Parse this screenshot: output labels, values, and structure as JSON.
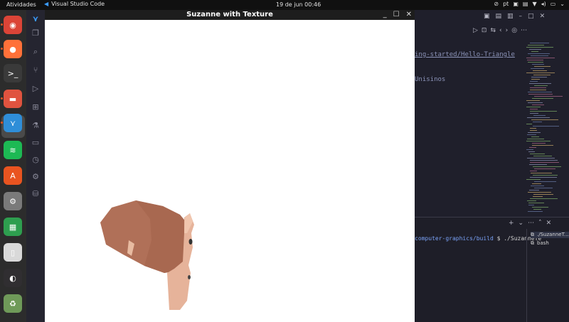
{
  "topbar": {
    "activities": "Atividades",
    "app_name": "Visual Studio Code",
    "clock": "19 de jun  00:46",
    "lang": "pt"
  },
  "dock": {
    "items": [
      {
        "icon": "chrome-icon",
        "color": "#db4437"
      },
      {
        "icon": "firefox-icon",
        "color": "#ff7139"
      },
      {
        "icon": "terminal-icon",
        "color": "#3a3a3a"
      },
      {
        "icon": "files-icon",
        "color": "#e0533f"
      },
      {
        "icon": "vscode-icon",
        "color": "#2f8ed8"
      },
      {
        "icon": "spotify-icon",
        "color": "#1db954"
      },
      {
        "icon": "app-center-icon",
        "color": "#e95420"
      },
      {
        "icon": "settings-icon",
        "color": "#7a7a7a"
      },
      {
        "icon": "spreadsheet-icon",
        "color": "#2e9e4f"
      },
      {
        "icon": "document-viewer-icon",
        "color": "#d9d9d9"
      },
      {
        "icon": "obs-icon",
        "color": "#302e31"
      },
      {
        "icon": "trash-icon",
        "color": "#6f9a59"
      }
    ]
  },
  "gl_window": {
    "title": "Suzanne with Texture"
  },
  "editor": {
    "breadcrumb": "ing-started/Hello-Triangle",
    "line2": "Unisinos"
  },
  "terminal": {
    "path": "computer-graphics/build",
    "command": "$ ./SuzanneTe",
    "tabs": [
      "./SuzanneT...",
      "bash"
    ]
  }
}
